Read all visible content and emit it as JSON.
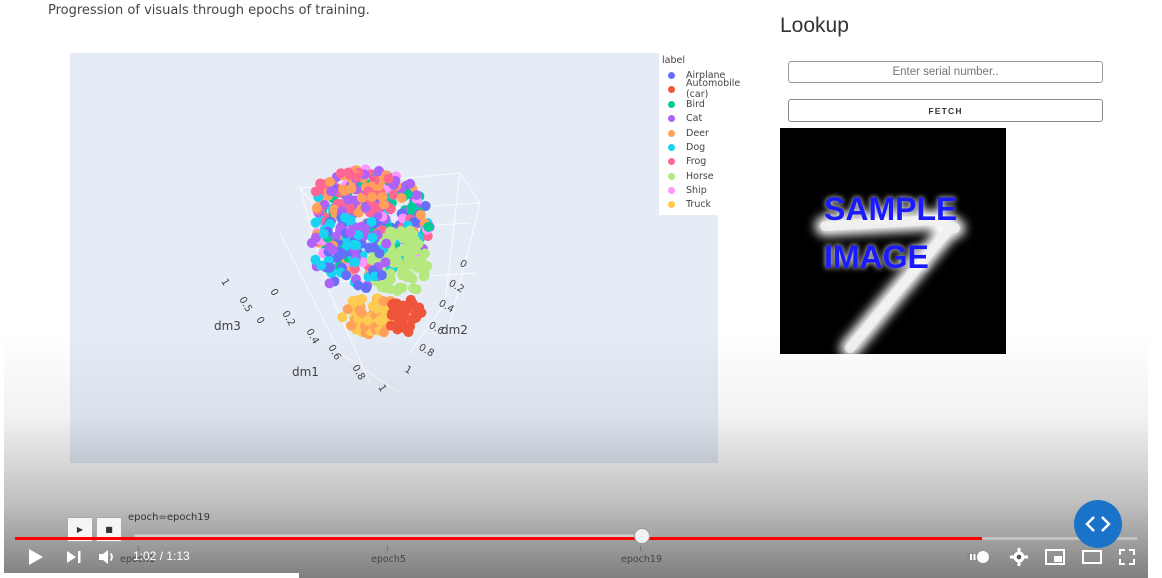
{
  "page": {
    "subtitle": "Progression of visuals through epochs of training."
  },
  "plot": {
    "legend_title": "label",
    "legend": [
      {
        "label": "Airplane",
        "color": "#636efa"
      },
      {
        "label": "Automobile (car)",
        "color": "#ef553b"
      },
      {
        "label": "Bird",
        "color": "#00cc96"
      },
      {
        "label": "Cat",
        "color": "#ab63fa"
      },
      {
        "label": "Deer",
        "color": "#ffa15a"
      },
      {
        "label": "Dog",
        "color": "#19d3f3"
      },
      {
        "label": "Frog",
        "color": "#ff6692"
      },
      {
        "label": "Horse",
        "color": "#b6e880"
      },
      {
        "label": "Ship",
        "color": "#ff97ff"
      },
      {
        "label": "Truck",
        "color": "#fecb52"
      }
    ],
    "axes": {
      "dm1": {
        "label": "dm1",
        "ticks": [
          "0",
          "0.2",
          "0.4",
          "0.6",
          "0.8",
          "1"
        ]
      },
      "dm2": {
        "label": "dm2",
        "ticks": [
          "0",
          "0.2",
          "0.4",
          "0.6",
          "0.8",
          "1"
        ]
      },
      "dm3": {
        "label": "dm3",
        "ticks": [
          "0",
          "0.5",
          "1"
        ]
      }
    },
    "animation": {
      "play_icon": "play-icon",
      "stop_icon": "stop-icon",
      "current_label": "epoch=epoch19",
      "ticks": [
        "epoch1",
        "epoch5",
        "epoch19"
      ]
    }
  },
  "lookup": {
    "title": "Lookup",
    "serial_placeholder": "Enter serial number..",
    "fetch_label": "FETCH",
    "image_text_line1": "SAMPLE",
    "image_text_line2": "IMAGE",
    "image_text_color": "#1a1aff"
  },
  "video": {
    "time": "1:02 / 1:13",
    "progress_fraction": 0.862,
    "accent": "#ff0000",
    "embed_color": "#1a73c8"
  }
}
